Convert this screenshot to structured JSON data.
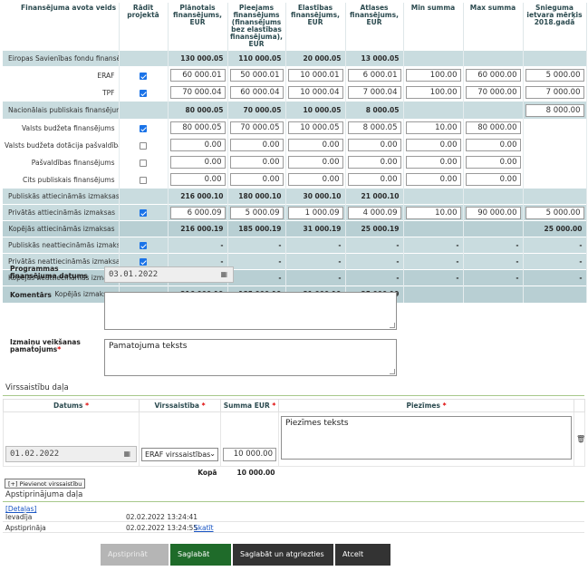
{
  "table": {
    "headers": [
      "Finansējuma avota veids",
      "Rādīt projektā",
      "Plānotais finansējums, EUR",
      "Pieejams finansējums (finansējums bez elastības finansējuma), EUR",
      "Elastības finansējums, EUR",
      "Atlases finansējums, EUR",
      "Min summa",
      "Max summa",
      "Snieguma ietvara mērķis 2018.gadā"
    ],
    "rows": [
      {
        "type": "sum",
        "label": "Eiropas Savienības fondu finansējums",
        "cells": [
          "130 000.05",
          "110 000.05",
          "20 000.05",
          "13 000.05",
          "",
          "",
          ""
        ]
      },
      {
        "type": "input",
        "label": "ERAF",
        "checked": true,
        "cells": [
          "60 000.01",
          "50 000.01",
          "10 000.01",
          "6 000.01",
          "100.00",
          "60 000.00",
          "5 000.00"
        ]
      },
      {
        "type": "input",
        "label": "TPF",
        "checked": true,
        "cells": [
          "70 000.04",
          "60 000.04",
          "10 000.04",
          "7 000.04",
          "100.00",
          "70 000.00",
          "7 000.00"
        ]
      },
      {
        "type": "sum2",
        "label": "Nacionālais publiskais finansējums",
        "cells": [
          "80 000.05",
          "70 000.05",
          "10 000.05",
          "8 000.05",
          "",
          "",
          ""
        ],
        "last_input": "8 000.00"
      },
      {
        "type": "input",
        "label": "Valsts budžeta finansējums",
        "checked": true,
        "cells": [
          "80 000.05",
          "70 000.05",
          "10 000.05",
          "8 000.05",
          "10.00",
          "80 000.00",
          ""
        ]
      },
      {
        "type": "input",
        "label": "Valsts budžeta dotācija pašvaldībām",
        "checked": false,
        "cells": [
          "0.00",
          "0.00",
          "0.00",
          "0.00",
          "0.00",
          "0.00",
          ""
        ]
      },
      {
        "type": "input",
        "label": "Pašvaldības finansējums",
        "checked": false,
        "cells": [
          "0.00",
          "0.00",
          "0.00",
          "0.00",
          "0.00",
          "0.00",
          ""
        ]
      },
      {
        "type": "input",
        "label": "Cits publiskais finansējums",
        "checked": false,
        "cells": [
          "0.00",
          "0.00",
          "0.00",
          "0.00",
          "0.00",
          "0.00",
          ""
        ]
      },
      {
        "type": "sum",
        "label": "Publiskās attiecināmās izmaksas",
        "cells": [
          "216 000.10",
          "180 000.10",
          "30 000.10",
          "21 000.10",
          "",
          "",
          ""
        ]
      },
      {
        "type": "input",
        "label": "Privātās attiecināmās izmaksas",
        "checked": true,
        "cells": [
          "6 000.09",
          "5 000.09",
          "1 000.09",
          "4 000.09",
          "10.00",
          "90 000.00",
          "5 000.00"
        ]
      },
      {
        "type": "sum",
        "label": "Kopējās attiecināmās izmaksas",
        "right": true,
        "cells": [
          "216 000.19",
          "185 000.19",
          "31 000.19",
          "25 000.19",
          "",
          "",
          "25 000.00"
        ]
      },
      {
        "type": "dash",
        "label": "Publiskās neattiecināmās izmaksas",
        "checked": true,
        "cells": [
          "-",
          "-",
          "-",
          "-",
          "-",
          "-",
          "-"
        ]
      },
      {
        "type": "dash",
        "label": "Privātās neattiecināmās izmaksas",
        "checked": true,
        "cells": [
          "-",
          "-",
          "-",
          "-",
          "-",
          "-",
          "-"
        ]
      },
      {
        "type": "dash2",
        "label": "Kopējās neattiecināmās izmaksas",
        "cells": [
          "-",
          "-",
          "-",
          "-",
          "-",
          "-",
          "-"
        ]
      },
      {
        "type": "total",
        "label": "Kopējās izmaksas",
        "cells": [
          "216 000.19",
          "185 000.19",
          "31 000.19",
          "25 000.19",
          "",
          "",
          ""
        ]
      }
    ]
  },
  "form": {
    "program_date_label": "Programmas finansējuma datums",
    "program_date_value": "03.01.2022",
    "comment_label": "Komentārs",
    "comment_value": "",
    "reason_label": "Izmaiņu veikšanas pamatojums",
    "reason_value": "Pamatojuma teksts"
  },
  "overdraft": {
    "section_title": "Virssaistību daļa",
    "col_date": "Datums",
    "col_overdraft": "Virssaistība",
    "col_sum": "Summa EUR",
    "col_notes": "Piezīmes",
    "row_date": "01.02.2022",
    "row_select": "ERAF virssaistības",
    "row_sum": "10 000.00",
    "row_notes": "Piezīmes teksts",
    "total_label": "Kopā",
    "total_value": "10 000.00",
    "add_button": "[+] Pievienot virssaistību"
  },
  "approval": {
    "section_title": "Apstiprinājuma daļa",
    "details_link": "[Detaļas]",
    "entered_label": "Ievadīja",
    "entered_time": "02.02.2022 13:24:41",
    "approved_label": "Apstiprināja",
    "approved_time": "02.02.2022 13:24:55",
    "view_link": "Skatīt"
  },
  "buttons": {
    "approve": "Apstiprināt",
    "save": "Saglabāt",
    "save_return": "Saglabāt un atgriezties",
    "cancel": "Atcelt"
  },
  "colors": {
    "sum_bg": "#c9dcdf",
    "save_green": "#1f6b2a",
    "dark_btn": "#333333",
    "disabled_btn": "#b5b5b5"
  }
}
